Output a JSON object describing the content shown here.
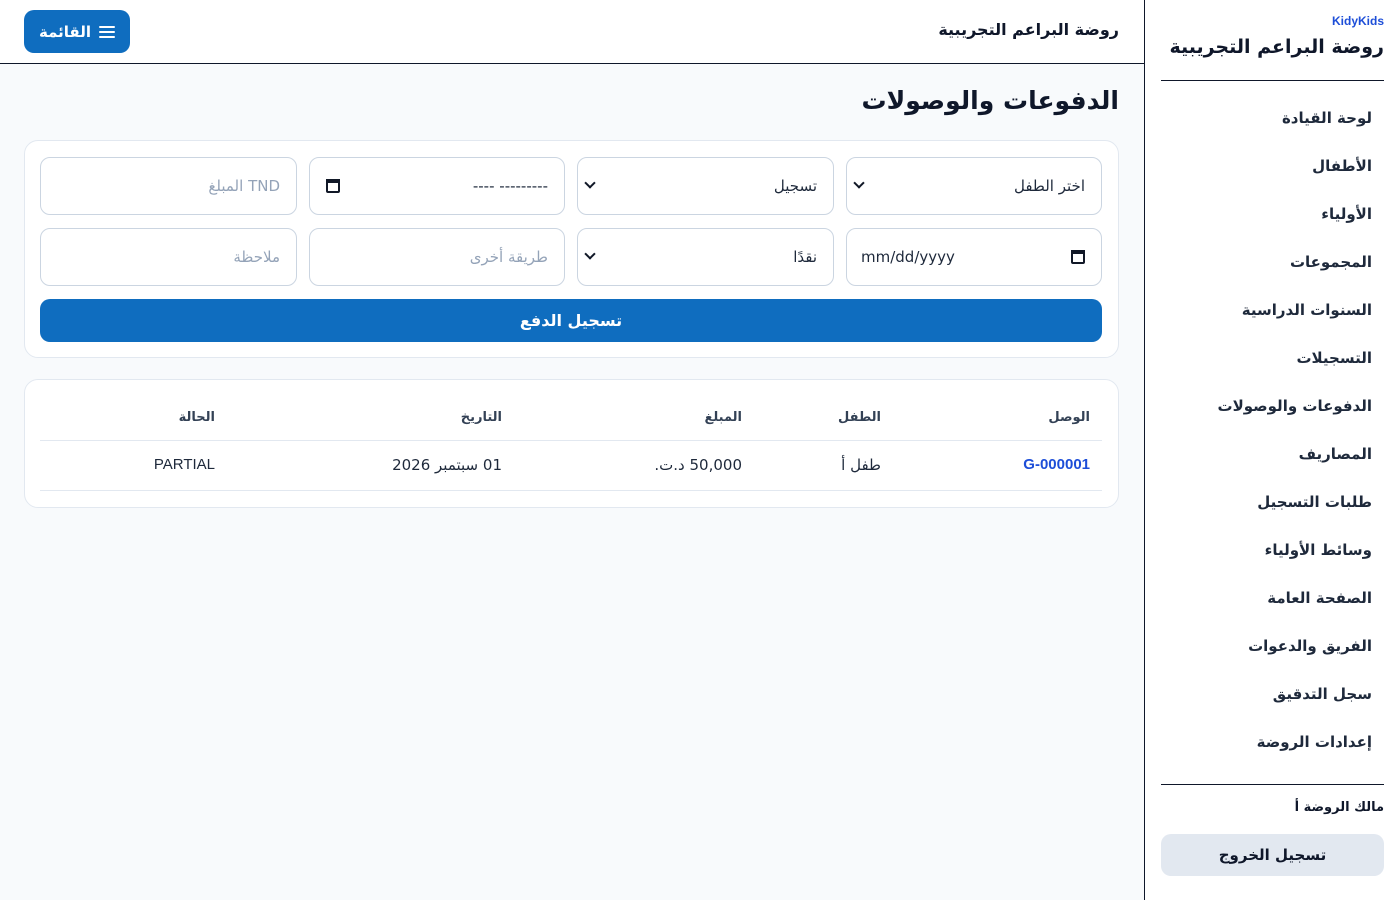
{
  "sidebar": {
    "brand_tag": "KidyKids",
    "brand_title": "روضة البراعم التجريبية",
    "items": [
      {
        "label": "لوحة القيادة"
      },
      {
        "label": "الأطفال"
      },
      {
        "label": "الأولياء"
      },
      {
        "label": "المجموعات"
      },
      {
        "label": "السنوات الدراسية"
      },
      {
        "label": "التسجيلات"
      },
      {
        "label": "الدفوعات والوصولات"
      },
      {
        "label": "المصاريف"
      },
      {
        "label": "طلبات التسجيل"
      },
      {
        "label": "وسائط الأولياء"
      },
      {
        "label": "الصفحة العامة"
      },
      {
        "label": "الفريق والدعوات"
      },
      {
        "label": "سجل التدقيق"
      },
      {
        "label": "إعدادات الروضة"
      }
    ],
    "owner": "مالك الروضة أ",
    "logout_label": "تسجيل الخروج"
  },
  "topbar": {
    "title": "روضة البراعم التجريبية",
    "menu_label": "القائمة"
  },
  "main": {
    "title": "الدفوعات والوصولات"
  },
  "form": {
    "child_select": "اختر الطفل",
    "type_select": "تسجيل",
    "month_value": "--------- ----",
    "amount_placeholder": "TND المبلغ",
    "date_placeholder": "mm/dd/yyyy",
    "method_select": "نقدًا",
    "other_method_placeholder": "طريقة أخرى",
    "note_placeholder": "ملاحظة",
    "submit_label": "تسجيل الدفع"
  },
  "table": {
    "headers": {
      "receipt": "الوصل",
      "child": "الطفل",
      "amount": "المبلغ",
      "date": "التاريخ",
      "status": "الحالة"
    },
    "rows": [
      {
        "receipt": "G-000001",
        "child": "طفل أ",
        "amount": "50,000 د.ت.",
        "date": "01 سبتمبر 2026",
        "status": "PARTIAL"
      }
    ]
  },
  "colors": {
    "primary": "#0f6dbf",
    "link": "#1d4ed8",
    "background": "#f8fafc"
  }
}
